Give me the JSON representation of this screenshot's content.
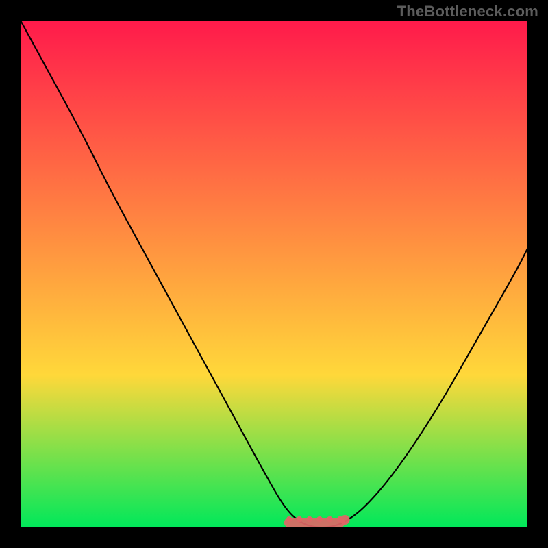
{
  "watermark": "TheBottleneck.com",
  "chart_data": {
    "type": "line",
    "title": "",
    "xlabel": "",
    "ylabel": "",
    "xlim": [
      0,
      100
    ],
    "ylim": [
      0,
      100
    ],
    "grid": false,
    "background_gradient": {
      "top": "#ff1a4b",
      "middle": "#ffd83a",
      "bottom": "#00e85a"
    },
    "series": [
      {
        "name": "bottleneck-curve",
        "color": "#000000",
        "x": [
          0,
          6,
          12,
          18,
          24,
          30,
          36,
          42,
          48,
          52,
          55,
          58,
          61,
          64,
          68,
          74,
          82,
          90,
          98,
          100
        ],
        "y": [
          100,
          89,
          78,
          66,
          55,
          44,
          33,
          22,
          11,
          4,
          1,
          0,
          0,
          1,
          4,
          11,
          23,
          37,
          51,
          55
        ]
      },
      {
        "name": "optimal-region-bar",
        "color": "#e06666",
        "x": [
          52,
          64
        ],
        "y": [
          0,
          0
        ],
        "style": "thick-bar"
      }
    ],
    "annotations": []
  }
}
